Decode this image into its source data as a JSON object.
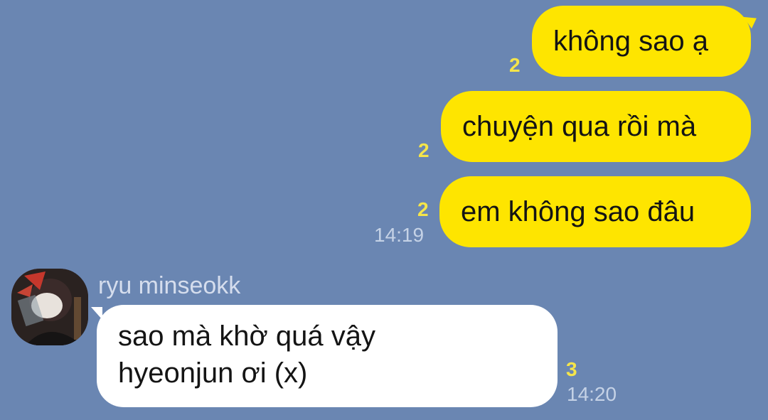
{
  "messages_out": [
    {
      "text": "không sao ạ",
      "unread": "2"
    },
    {
      "text": "chuyện qua rồi mà",
      "unread": "2"
    },
    {
      "text": "em không sao đâu",
      "unread": "2",
      "time": "14:19"
    }
  ],
  "message_in": {
    "sender": "ryu minseokk",
    "line1": "sao mà khờ quá vậy",
    "line2": "hyeonjun ơi (x)",
    "unread": "3",
    "time": "14:20"
  },
  "colors": {
    "background": "#6a86b2",
    "outgoing_bubble": "#fee500",
    "incoming_bubble": "#ffffff",
    "unread_count": "#f5e54a",
    "timestamp": "#c5d2e6"
  }
}
